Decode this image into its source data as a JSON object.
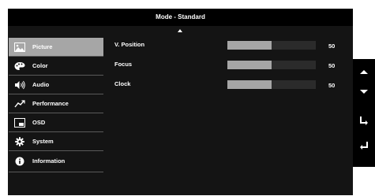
{
  "header": {
    "title": "Mode - Standard"
  },
  "menu": {
    "items": [
      {
        "label": "Picture",
        "icon": "picture-icon",
        "active": true
      },
      {
        "label": "Color",
        "icon": "palette-icon",
        "active": false
      },
      {
        "label": "Audio",
        "icon": "speaker-icon",
        "active": false
      },
      {
        "label": "Performance",
        "icon": "performance-icon",
        "active": false
      },
      {
        "label": "OSD",
        "icon": "osd-icon",
        "active": false
      },
      {
        "label": "System",
        "icon": "gear-icon",
        "active": false
      },
      {
        "label": "Information",
        "icon": "info-icon",
        "active": false
      }
    ]
  },
  "settings": {
    "rows": [
      {
        "label": "V. Position",
        "value": "50",
        "level": 0.5
      },
      {
        "label": "Focus",
        "value": "50",
        "level": 0.5
      },
      {
        "label": "Clock",
        "value": "50",
        "level": 0.5
      }
    ]
  },
  "side_buttons": [
    "up-arrow-icon",
    "down-arrow-icon",
    "enter-icon",
    "return-icon"
  ],
  "colors": {
    "panel": "#141414",
    "header": "#000000",
    "active_item": "#a6a6a6",
    "slider_fill": "#a6a6a6",
    "text": "#ffffff"
  }
}
